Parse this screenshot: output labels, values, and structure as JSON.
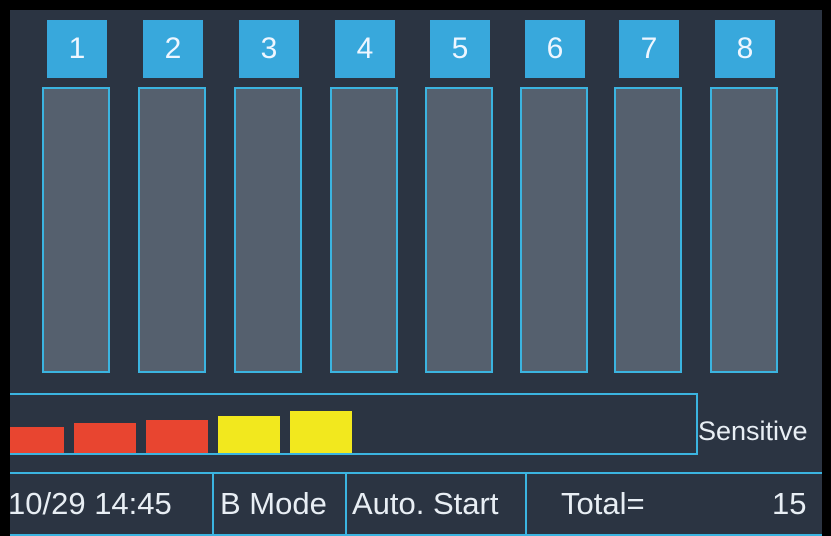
{
  "channels": [
    {
      "label": "1"
    },
    {
      "label": "2"
    },
    {
      "label": "3"
    },
    {
      "label": "4"
    },
    {
      "label": "5"
    },
    {
      "label": "6"
    },
    {
      "label": "7"
    },
    {
      "label": "8"
    }
  ],
  "sensitivity": {
    "label": "Sensitive",
    "level": 5,
    "segments": [
      {
        "color": "#e84530"
      },
      {
        "color": "#e84530"
      },
      {
        "color": "#e84530"
      },
      {
        "color": "#f2e81e"
      },
      {
        "color": "#f2e81e"
      }
    ]
  },
  "status": {
    "datetime": "10/29 14:45",
    "mode": "B Mode",
    "start": "Auto. Start",
    "total_label": "Total=",
    "total_value": "15"
  },
  "colors": {
    "accent": "#3bb4e0",
    "background": "#2b3442",
    "bar_fill": "#55606e",
    "channel_tag": "#38a8dc"
  }
}
